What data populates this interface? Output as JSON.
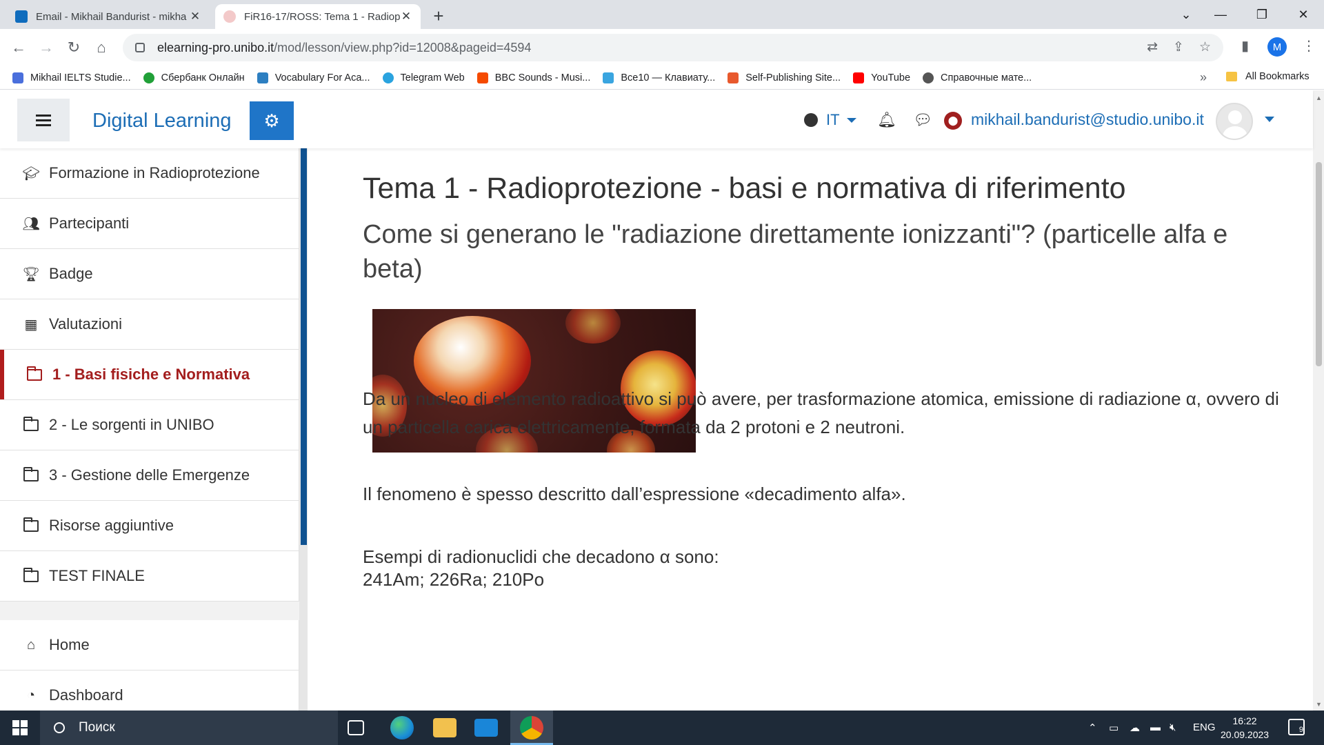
{
  "browser": {
    "tabs": [
      {
        "title": "Email - Mikhail Bandurist - mikha",
        "favicon_color": "#0f6cbd",
        "active": false
      },
      {
        "title": "FiR16-17/ROSS: Tema 1 - Radiopr",
        "favicon_color": "#e8a0a0",
        "active": true
      }
    ],
    "new_tab_label": "+",
    "url_host": "elearning-pro.unibo.it",
    "url_path": "/mod/lesson/view.php?id=12008&pageid=4594",
    "profile_initial": "M",
    "bookmarks": [
      {
        "label": "Mikhail IELTS Studie...",
        "icon_color": "#4a6fdc"
      },
      {
        "label": "Сбербанк Онлайн",
        "icon_color": "#21a038"
      },
      {
        "label": "Vocabulary For Aca...",
        "icon_color": "#2d7fc1"
      },
      {
        "label": "Telegram Web",
        "icon_color": "#2aa3df"
      },
      {
        "label": "BBC Sounds - Musi...",
        "icon_color": "#f54a00"
      },
      {
        "label": "Все10 — Клавиату...",
        "icon_color": "#3aa5e0"
      },
      {
        "label": "Self-Publishing Site...",
        "icon_color": "#e8592d"
      },
      {
        "label": "YouTube",
        "icon_color": "#ff0000"
      },
      {
        "label": "Справочные мате...",
        "icon_color": "#555555"
      }
    ],
    "bookmarks_more": "»",
    "all_bookmarks": "All Bookmarks"
  },
  "navbar": {
    "brand": "Digital Learning",
    "language": "IT",
    "user_email": "mikhail.bandurist@studio.unibo.it"
  },
  "drawer": {
    "items": [
      {
        "label": "Formazione in Radioprotezione",
        "icon": "graduation-cap-icon"
      },
      {
        "label": "Partecipanti",
        "icon": "users-icon"
      },
      {
        "label": "Badge",
        "icon": "trophy-icon"
      },
      {
        "label": "Valutazioni",
        "icon": "table-icon"
      },
      {
        "label": "1 - Basi fisiche e Normativa",
        "icon": "folder-icon",
        "active": true
      },
      {
        "label": "2 - Le sorgenti in UNIBO",
        "icon": "folder-icon"
      },
      {
        "label": "3 - Gestione delle Emergenze",
        "icon": "folder-icon"
      },
      {
        "label": "Risorse aggiuntive",
        "icon": "folder-icon"
      },
      {
        "label": "TEST FINALE",
        "icon": "folder-icon"
      }
    ],
    "items2": [
      {
        "label": "Home",
        "icon": "home-icon"
      },
      {
        "label": "Dashboard",
        "icon": "dashboard-icon"
      }
    ]
  },
  "content": {
    "title": "Tema 1 - Radioprotezione - basi e normativa di riferimento",
    "subtitle": "Come si generano le \"radiazione direttamente ionizzanti\"? (particelle alfa e beta)",
    "paragraph1": "Da un nucleo di elemento radioattivo si può avere, per trasformazione atomica, emissione di radiazione α, ovvero di un particella carica elettricamente, formata da 2 protoni e 2 neutroni.",
    "paragraph2": "Il fenomeno è spesso descritto dall’espressione «decadimento alfa».",
    "paragraph3": "Esempi di radionuclidi che decadono α sono:",
    "paragraph4": "241Am; 226Ra; 210Po"
  },
  "taskbar": {
    "search_placeholder": "Поиск",
    "language": "ENG",
    "time": "16:22",
    "date": "20.09.2023",
    "notifications": "9"
  }
}
